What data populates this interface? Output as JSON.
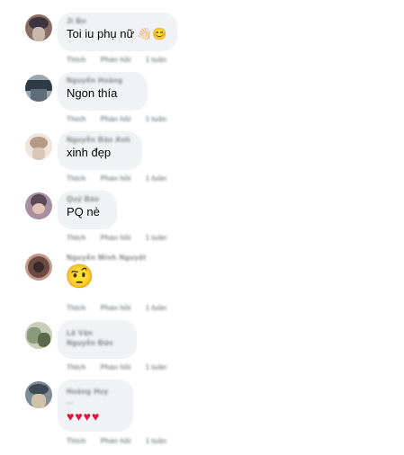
{
  "comments": [
    {
      "author": "Ji Bo",
      "text": "Toi iu phụ nữ 👋🏻😊",
      "actions": [
        "Thích",
        "Phản hồi",
        "1 tuần"
      ],
      "avatar_colors": [
        "#3a3540",
        "#8b6e63",
        "#c9b7a8"
      ]
    },
    {
      "author": "Nguyễn Hoàng",
      "text": "Ngon thía",
      "actions": [
        "Thích",
        "Phản hồi",
        "1 tuần"
      ],
      "avatar_colors": [
        "#2e3b47",
        "#5d6d7a",
        "#9aa6ad"
      ]
    },
    {
      "author": "Nguyễn Bảo Anh",
      "text": "xinh đẹp",
      "actions": [
        "Thích",
        "Phản hồi",
        "1 tuần"
      ],
      "avatar_colors": [
        "#d9c7b8",
        "#b59a87",
        "#efe5dc"
      ]
    },
    {
      "author": "Quý Bảo",
      "text": "PQ nè",
      "actions": [
        "Thích",
        "Phản hồi",
        "1 tuần"
      ],
      "avatar_colors": [
        "#5b4a58",
        "#a68fa0",
        "#e5c2b8"
      ]
    },
    {
      "author": "Nguyễn Minh Nguyệt",
      "text": "🤨",
      "actions": [
        "Thích",
        "Phản hồi",
        "1 tuần"
      ],
      "avatar_colors": [
        "#6e4a45",
        "#c59a8c",
        "#3b2a2a"
      ]
    },
    {
      "author": "Lê Văn",
      "author_line2": "Nguyễn Đức",
      "text": "",
      "actions": [
        "Thích",
        "Phản hồi",
        "1 tuần"
      ],
      "avatar_colors": [
        "#8a9a7b",
        "#c7cfb8",
        "#5b6b4a"
      ]
    },
    {
      "author": "Hoàng Huy",
      "author_line2": "...",
      "text": "♥♥♥♥",
      "actions": [
        "Thích",
        "Phản hồi",
        "1 tuần"
      ],
      "avatar_colors": [
        "#3e4a55",
        "#7e8c97",
        "#d0c2a8"
      ]
    }
  ]
}
